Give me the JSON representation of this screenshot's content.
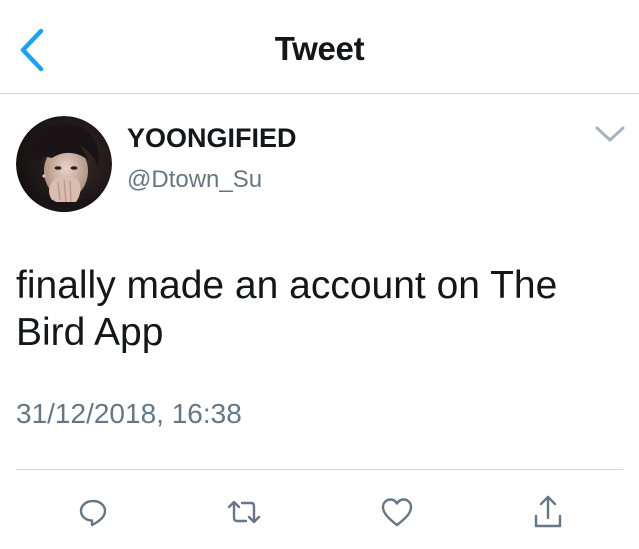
{
  "header": {
    "title": "Tweet",
    "back_icon": "chevron-left-icon"
  },
  "author": {
    "display_name": "YOONGIFIED",
    "handle": "@Dtown_Su",
    "avatar_icon": "avatar-photo"
  },
  "tweet": {
    "text": "finally made an account on The Bird App",
    "timestamp": "31/12/2018, 16:38"
  },
  "actions": [
    {
      "name": "reply",
      "icon": "reply-icon"
    },
    {
      "name": "retweet",
      "icon": "retweet-icon"
    },
    {
      "name": "like",
      "icon": "heart-icon"
    },
    {
      "name": "share",
      "icon": "share-icon"
    }
  ],
  "colors": {
    "accent": "#1da1f2",
    "text": "#14171a",
    "secondary_text": "#657786",
    "divider": "#d6d9dc",
    "icon": "#657786"
  }
}
